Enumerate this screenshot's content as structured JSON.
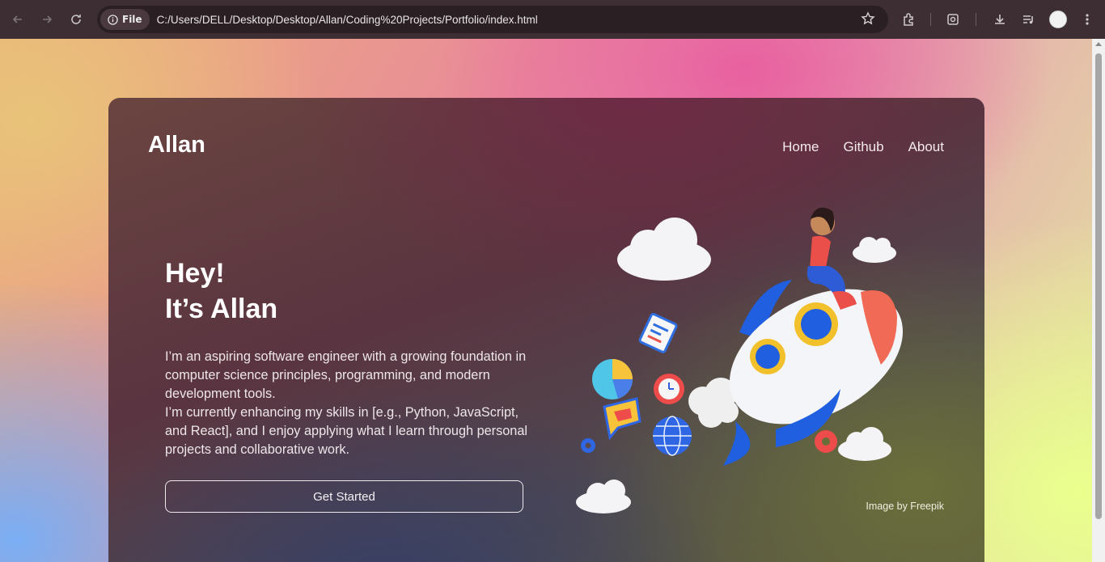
{
  "browser": {
    "url_chip_label": "File",
    "url": "C:/Users/DELL/Desktop/Desktop/Allan/Coding%20Projects/Portfolio/index.html",
    "icons": [
      "back-icon",
      "forward-icon",
      "reload-icon",
      "info-icon",
      "star-icon",
      "extensions-icon",
      "screenshot-icon",
      "download-icon",
      "media-controls-icon",
      "profile-avatar",
      "menu-icon"
    ]
  },
  "header": {
    "logo": "Allan",
    "nav": [
      {
        "label": "Home"
      },
      {
        "label": "Github"
      },
      {
        "label": "About"
      }
    ]
  },
  "hero": {
    "title_line1": "Hey!",
    "title_line2": "It’s Allan",
    "description_1": "I’m an aspiring software engineer with a growing foundation in computer science principles, programming, and modern development tools.",
    "description_2": "I’m currently enhancing my skills in [e.g., Python, JavaScript, and React], and I enjoy applying what I learn through personal projects and collaborative work.",
    "cta_label": "Get Started",
    "image_credit": "Image by Freepik"
  },
  "colors": {
    "card_bg": "#5a3a44",
    "text": "#ffffff",
    "rocket_blue": "#1f5fe0",
    "rocket_red": "#f06a55"
  }
}
